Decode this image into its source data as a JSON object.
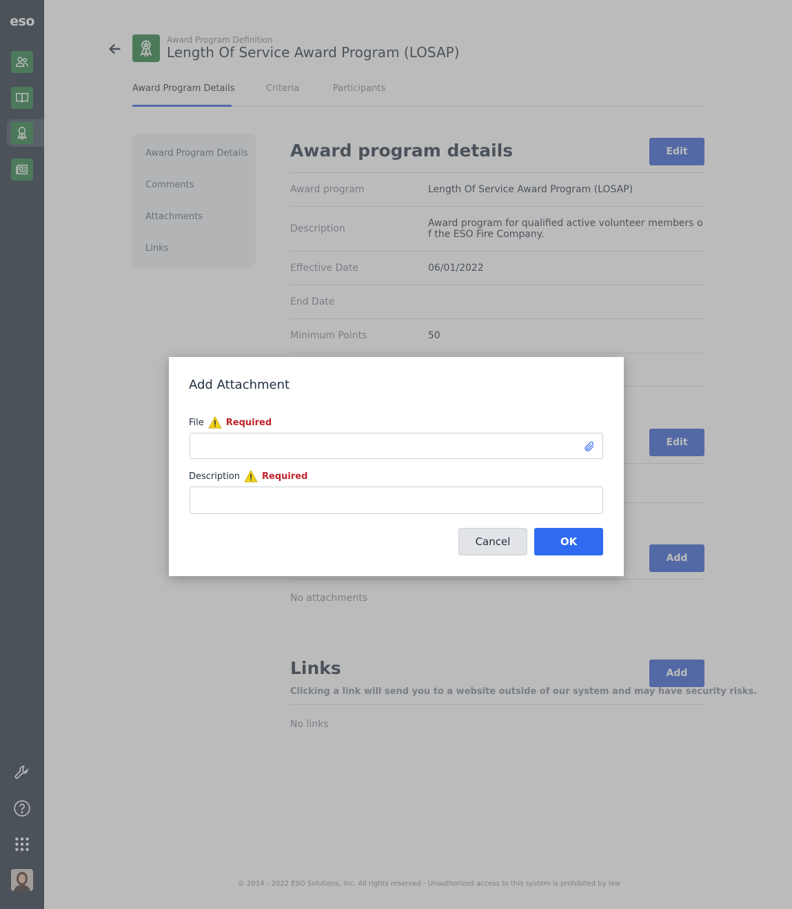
{
  "rail": {
    "logo": "eso",
    "apps": [
      "people-icon",
      "book-icon",
      "award-ribbon-icon",
      "news-icon"
    ],
    "tools": [
      "wrench-icon",
      "help-icon",
      "apps-grid-icon"
    ],
    "active_app": "award-ribbon-icon",
    "accent_color": "#1f7a3c"
  },
  "header": {
    "supertitle": "Award Program Definition",
    "title": "Length Of Service Award Program (LOSAP)"
  },
  "tabs": [
    {
      "label": "Award Program Details",
      "active": true
    },
    {
      "label": "Criteria",
      "active": false
    },
    {
      "label": "Participants",
      "active": false
    }
  ],
  "subnav": [
    "Award Program Details",
    "Comments",
    "Attachments",
    "Links"
  ],
  "details": {
    "heading": "Award program details",
    "edit_label": "Edit",
    "rows": [
      {
        "key": "Award program",
        "value": "Length Of Service Award Program (LOSAP)"
      },
      {
        "key": "Description",
        "value": "Award program for qualified active volunteer members of the ESO Fire Company."
      },
      {
        "key": "Effective Date",
        "value": "06/01/2022"
      },
      {
        "key": "End Date",
        "value": ""
      },
      {
        "key": "Minimum Points",
        "value": "50"
      }
    ]
  },
  "comments": {
    "edit_label": "Edit"
  },
  "attachments": {
    "add_label": "Add",
    "empty": "No attachments"
  },
  "links": {
    "heading": "Links",
    "add_label": "Add",
    "warning": "Clicking a link will send you to a website outside of our system and may have security risks.",
    "empty": "No links"
  },
  "footer": "© 2014 - 2022 ESO Solutions, Inc. All rights reserved - Unauthorized access to this system is prohibited by law",
  "modal": {
    "title": "Add Attachment",
    "file_label": "File",
    "file_required": "Required",
    "description_label": "Description",
    "description_required": "Required",
    "file_value": "",
    "description_value": "",
    "cancel_label": "Cancel",
    "ok_label": "OK"
  }
}
